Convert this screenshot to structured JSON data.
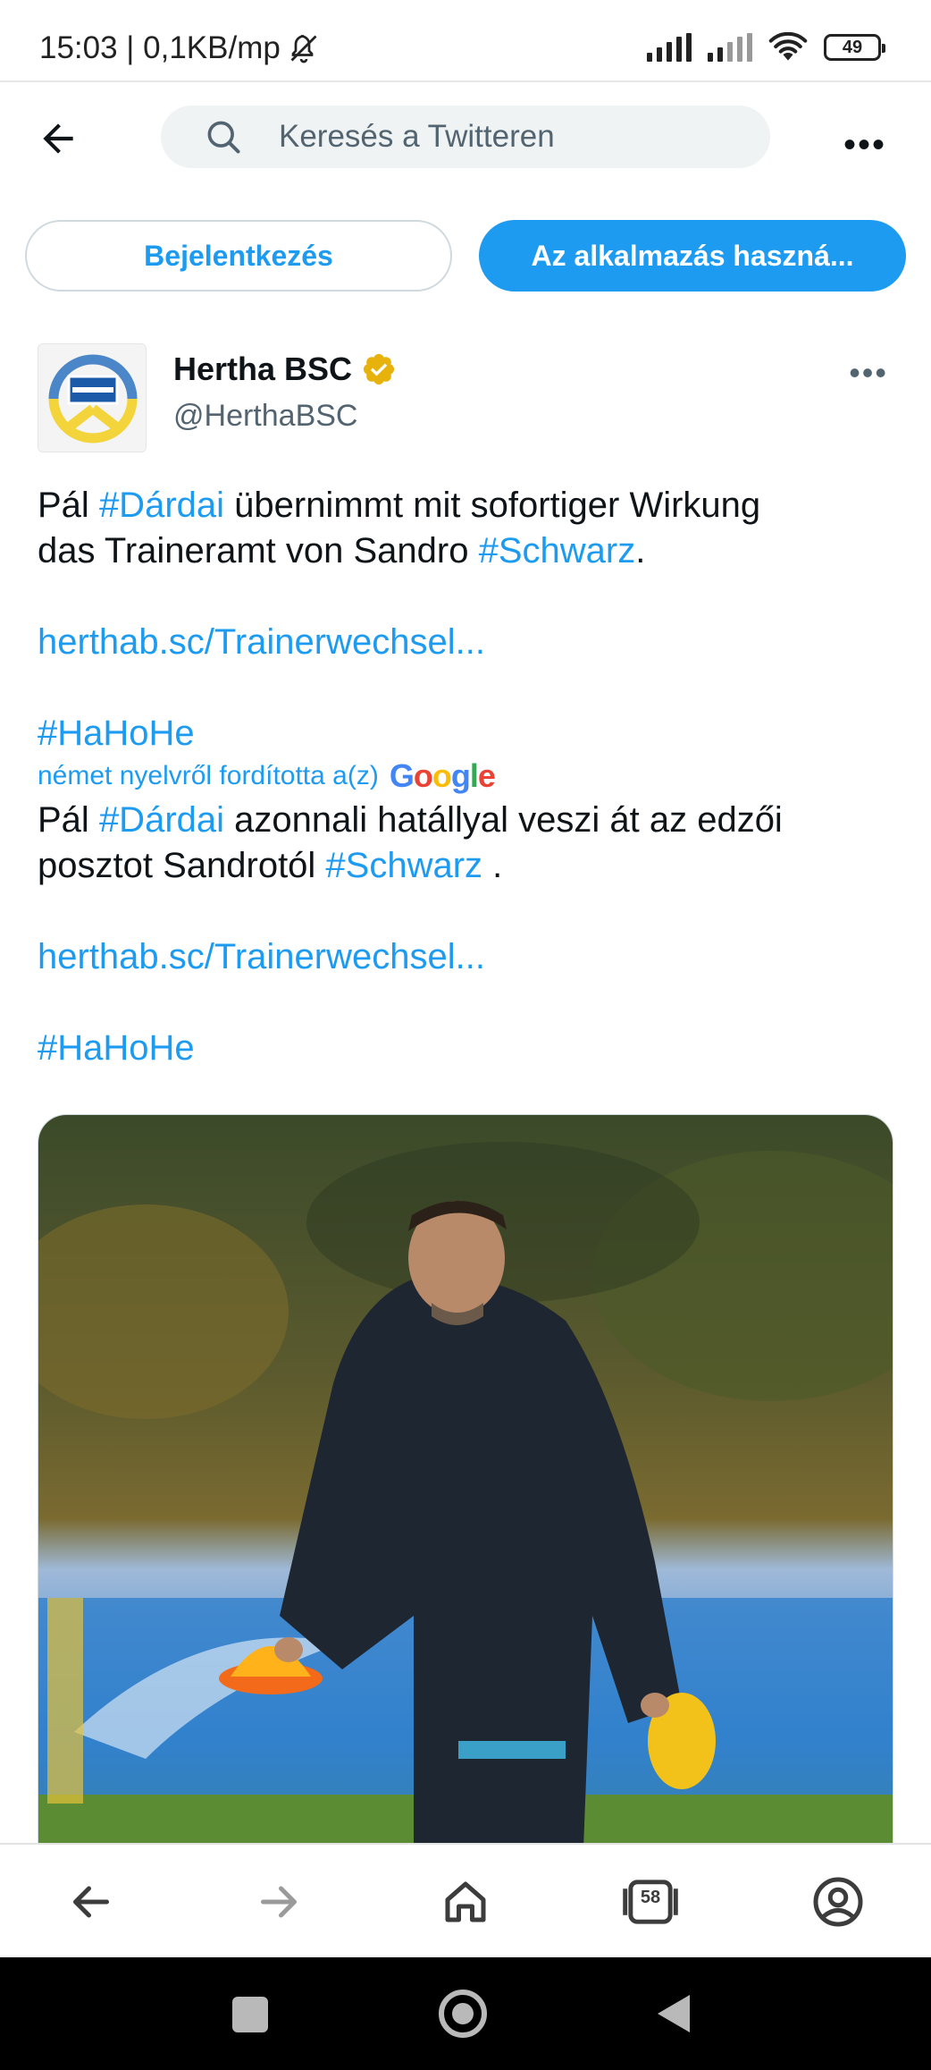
{
  "status_bar": {
    "time_text": "15:03 | 0,1KB/mp",
    "battery": "49"
  },
  "search": {
    "placeholder": "Keresés a Twitteren"
  },
  "buttons": {
    "login": "Bejelentkezés",
    "use_app": "Az alkalmazás haszná..."
  },
  "tweet": {
    "author_name": "Hertha BSC",
    "author_handle": "@HerthaBSC",
    "original": {
      "line1_a": "Pál ",
      "line1_tag": "#Dárdai",
      "line1_b": " übernimmt mit sofortiger Wirkung",
      "line2_a": "das Traineramt von Sandro ",
      "line2_tag": "#Schwarz",
      "line2_b": ".",
      "link": "herthab.sc/Trainerwechsel...",
      "hashtag": "#HaHoHe"
    },
    "translated_by": "német nyelvről fordította a(z)",
    "google_logo": "Google",
    "translation": {
      "line1_a": "Pál ",
      "line1_tag": "#Dárdai",
      "line1_b": " azonnali hatállyal veszi át az edzői",
      "line2_a": "posztot Sandrotól ",
      "line2_tag": "#Schwarz",
      "line2_b": " .",
      "link": "herthab.sc/Trainerwechsel...",
      "hashtag": "#HaHoHe"
    }
  },
  "browser_nav": {
    "tabs_count": "58"
  },
  "colors": {
    "accent": "#1d9bf0",
    "text": "#0f1419",
    "secondary_text": "#536471",
    "verified": "#e8b20d"
  }
}
